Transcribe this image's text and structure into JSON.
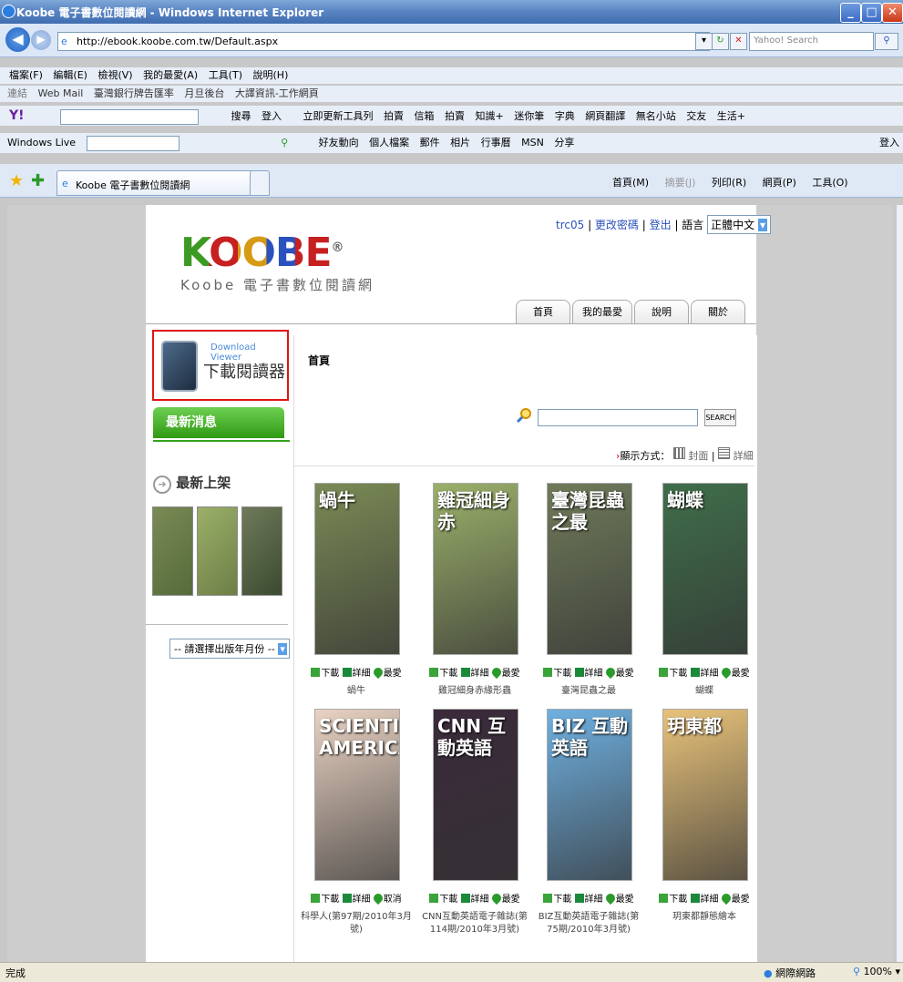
{
  "window": {
    "title": "Koobe 電子書數位閱讀網 - Windows Internet Explorer"
  },
  "address": {
    "url": "http://ebook.koobe.com.tw/Default.aspx",
    "search_placeholder": "Yahoo! Search"
  },
  "menu": [
    "檔案(F)",
    "編輯(E)",
    "檢視(V)",
    "我的最愛(A)",
    "工具(T)",
    "說明(H)"
  ],
  "favbar": {
    "label": "連結",
    "items": [
      "Web Mail",
      "臺灣銀行牌告匯率",
      "月旦後台",
      "大譯資訊-工作網頁"
    ]
  },
  "yahoobar": [
    "搜尋",
    "登入",
    "立即更新工具列",
    "拍賣",
    "信箱",
    "拍賣",
    "知識+",
    "迷你筆",
    "字典",
    "網頁翻譯",
    "無名小站",
    "交友",
    "生活+"
  ],
  "livebar": {
    "label": "Windows Live",
    "items": [
      "好友動向",
      "個人檔案",
      "郵件",
      "相片",
      "行事曆",
      "MSN",
      "分享"
    ],
    "signin": "登入"
  },
  "tab": {
    "title": "Koobe 電子書數位閱讀網"
  },
  "cmdbar": [
    "首頁(M)",
    "摘要(J)",
    "列印(R)",
    "網頁(P)",
    "工具(O)"
  ],
  "site": {
    "logo": "KOOBE",
    "logo_mark": "®",
    "logo_sub": "Koobe 電子書數位閱讀網",
    "user": "trc05",
    "change_pw": "更改密碼",
    "logout": "登出",
    "lang_label": "語言",
    "lang_value": "正體中文",
    "nav": [
      "首頁",
      "我的最愛",
      "說明",
      "關於"
    ],
    "download_en": "Download Viewer",
    "download_zh": "下載閱讀器",
    "news": "最新消息",
    "new_arrivals": "最新上架",
    "year_select": "-- 請選擇出版年月份 --",
    "main_title": "首頁",
    "search_btn": "SEARCH",
    "view_label": "顯示方式：",
    "view_cover": "封面",
    "view_detail": "詳細"
  },
  "books": [
    {
      "title": "蝸牛",
      "cover_text": "蝸牛",
      "fav": "最愛",
      "bg": "#7a8a55"
    },
    {
      "title": "雞冠細身赤緣形蟲",
      "cover_text": "雞冠細身赤",
      "fav": "最愛",
      "bg": "#9bb06a"
    },
    {
      "title": "臺灣昆蟲之最",
      "cover_text": "臺灣昆蟲之最",
      "fav": "最愛",
      "bg": "#6f7a5a"
    },
    {
      "title": "蝴蝶",
      "cover_text": "蝴蝶",
      "fav": "最愛",
      "bg": "#3f6e4a"
    },
    {
      "title": "科學人(第97期/2010年3月號)",
      "cover_text": "SCIENTIFIC AMERICAN",
      "fav": "取消",
      "bg": "#e9d2c2"
    },
    {
      "title": "CNN互動英語電子雜誌(第114期/2010年3月號)",
      "cover_text": "CNN 互動英語",
      "fav": "最愛",
      "bg": "#3a2a3a"
    },
    {
      "title": "BIZ互動英語電子雜誌(第75期/2010年3月號)",
      "cover_text": "BIZ 互動英語",
      "fav": "最愛",
      "bg": "#6fb0e0"
    },
    {
      "title": "玥東都靜態繪本",
      "cover_text": "玥東都",
      "fav": "最愛",
      "bg": "#e8c27a"
    }
  ],
  "actions": {
    "download": "下載",
    "detail": "詳細"
  },
  "status": {
    "text": "完成",
    "zone": "網際網路",
    "zoom": "100%"
  }
}
